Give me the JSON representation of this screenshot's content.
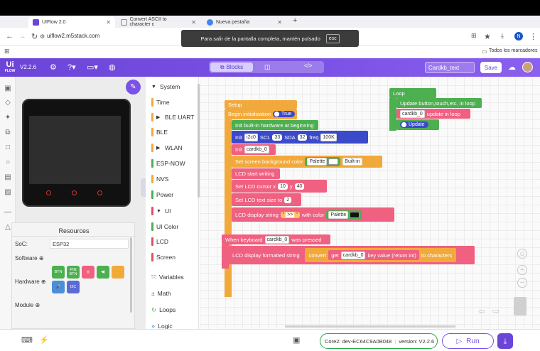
{
  "browser": {
    "tabs": [
      {
        "title": "UIFlow 2.0"
      },
      {
        "title": "Convert ASCII to character c"
      },
      {
        "title": "Nueva pestaña"
      }
    ],
    "new_tab": "+",
    "url": "uiflow2.m5stack.com",
    "fullscreen_notice": "Para salir de la pantalla completa, mantén pulsado",
    "fullscreen_key": "esc",
    "bookmarks_label": "Todos los marcadores",
    "profile_initial": "N"
  },
  "app": {
    "logo_line1": "Ui",
    "logo_line2": "FLOW",
    "version": "V2.2.6",
    "view_blocks": "Blocks",
    "project_name": "Cardkb_text",
    "save": "Save"
  },
  "resources": {
    "title": "Resources",
    "soc_label": "SoC:",
    "soc_value": "ESP32",
    "software_label": "Software",
    "hardware_label": "Hardware",
    "module_label": "Module",
    "hw_buttons": [
      "BTN",
      "PIN BTN",
      "",
      "",
      "",
      "",
      "I2C"
    ]
  },
  "categories": [
    {
      "label": "System",
      "color": "#3b3b3b",
      "expanded": true
    },
    {
      "label": "Time",
      "color": "#f2a93b"
    },
    {
      "label": "BLE UART",
      "color": "#3b3b3b",
      "collapsed": true
    },
    {
      "label": "BLE",
      "color": "#f2a93b"
    },
    {
      "label": "WLAN",
      "color": "#3b3b3b",
      "collapsed": true
    },
    {
      "label": "ESP-NOW",
      "color": "#4caf50"
    },
    {
      "label": "NVS",
      "color": "#f2a93b"
    },
    {
      "label": "Power",
      "color": "#4caf50"
    },
    {
      "label": "UI",
      "color": "#3b3b3b",
      "expanded": true
    },
    {
      "label": "UI Color",
      "color": "#4caf50"
    },
    {
      "label": "LCD",
      "color": "#e05060"
    },
    {
      "label": "Screen",
      "color": "#e05060"
    },
    {
      "label": "Variables",
      "color": "#a05a9e"
    },
    {
      "label": "Math",
      "color": "#4a6cd4"
    },
    {
      "label": "Loops",
      "color": "#4caf50"
    },
    {
      "label": "Logic",
      "color": "#4a90d9"
    }
  ],
  "blocks": {
    "setup": "Setup",
    "begin_init": "Begin initialization",
    "true_label": "True",
    "init_hw": "Init built-in hardware at beginning",
    "init": "Init",
    "i2c0": "i2c0",
    "scl": "SCL",
    "scl_val": "33",
    "sda": "SDA",
    "sda_val": "32",
    "freq": "freq",
    "freq_val": "100K",
    "cardkb_0": "cardkb_0",
    "set_bg": "Set screen background color",
    "palette": "Palette",
    "builtin": "Built-in",
    "lcd_start": "LCD start writing",
    "set_cursor": "Set LCD cursor x",
    "cursor_x": "10",
    "y": "y",
    "cursor_y": "40",
    "set_text_size": "Set LCD text size to",
    "text_size": "2",
    "display_string": "LCD display string",
    "prompt": ">>",
    "with_color": "with color",
    "loop": "Loop",
    "update_loop": "Update button,touch,etc. in loop",
    "update_in_loop": "update in loop",
    "update": "Update",
    "when_keyboard": "When keyboard",
    "was_pressed": "was pressed",
    "display_formatted": "LCD display formatted string",
    "convert": "convert",
    "get": "get",
    "key_value": "key value (return int)",
    "to_characters": "to characters"
  },
  "bottom": {
    "device": "Core2: dev-EC64C9A0B048",
    "version_label": "version: V2.2.6",
    "run": "Run"
  },
  "colors": {
    "accent": "#7b52e6",
    "setup_orange": "#f2a93b",
    "loop_green": "#4caf50",
    "hw_blue": "#3a4ac9",
    "lcd_pink": "#f06080",
    "status_green": "#2aa84a"
  }
}
